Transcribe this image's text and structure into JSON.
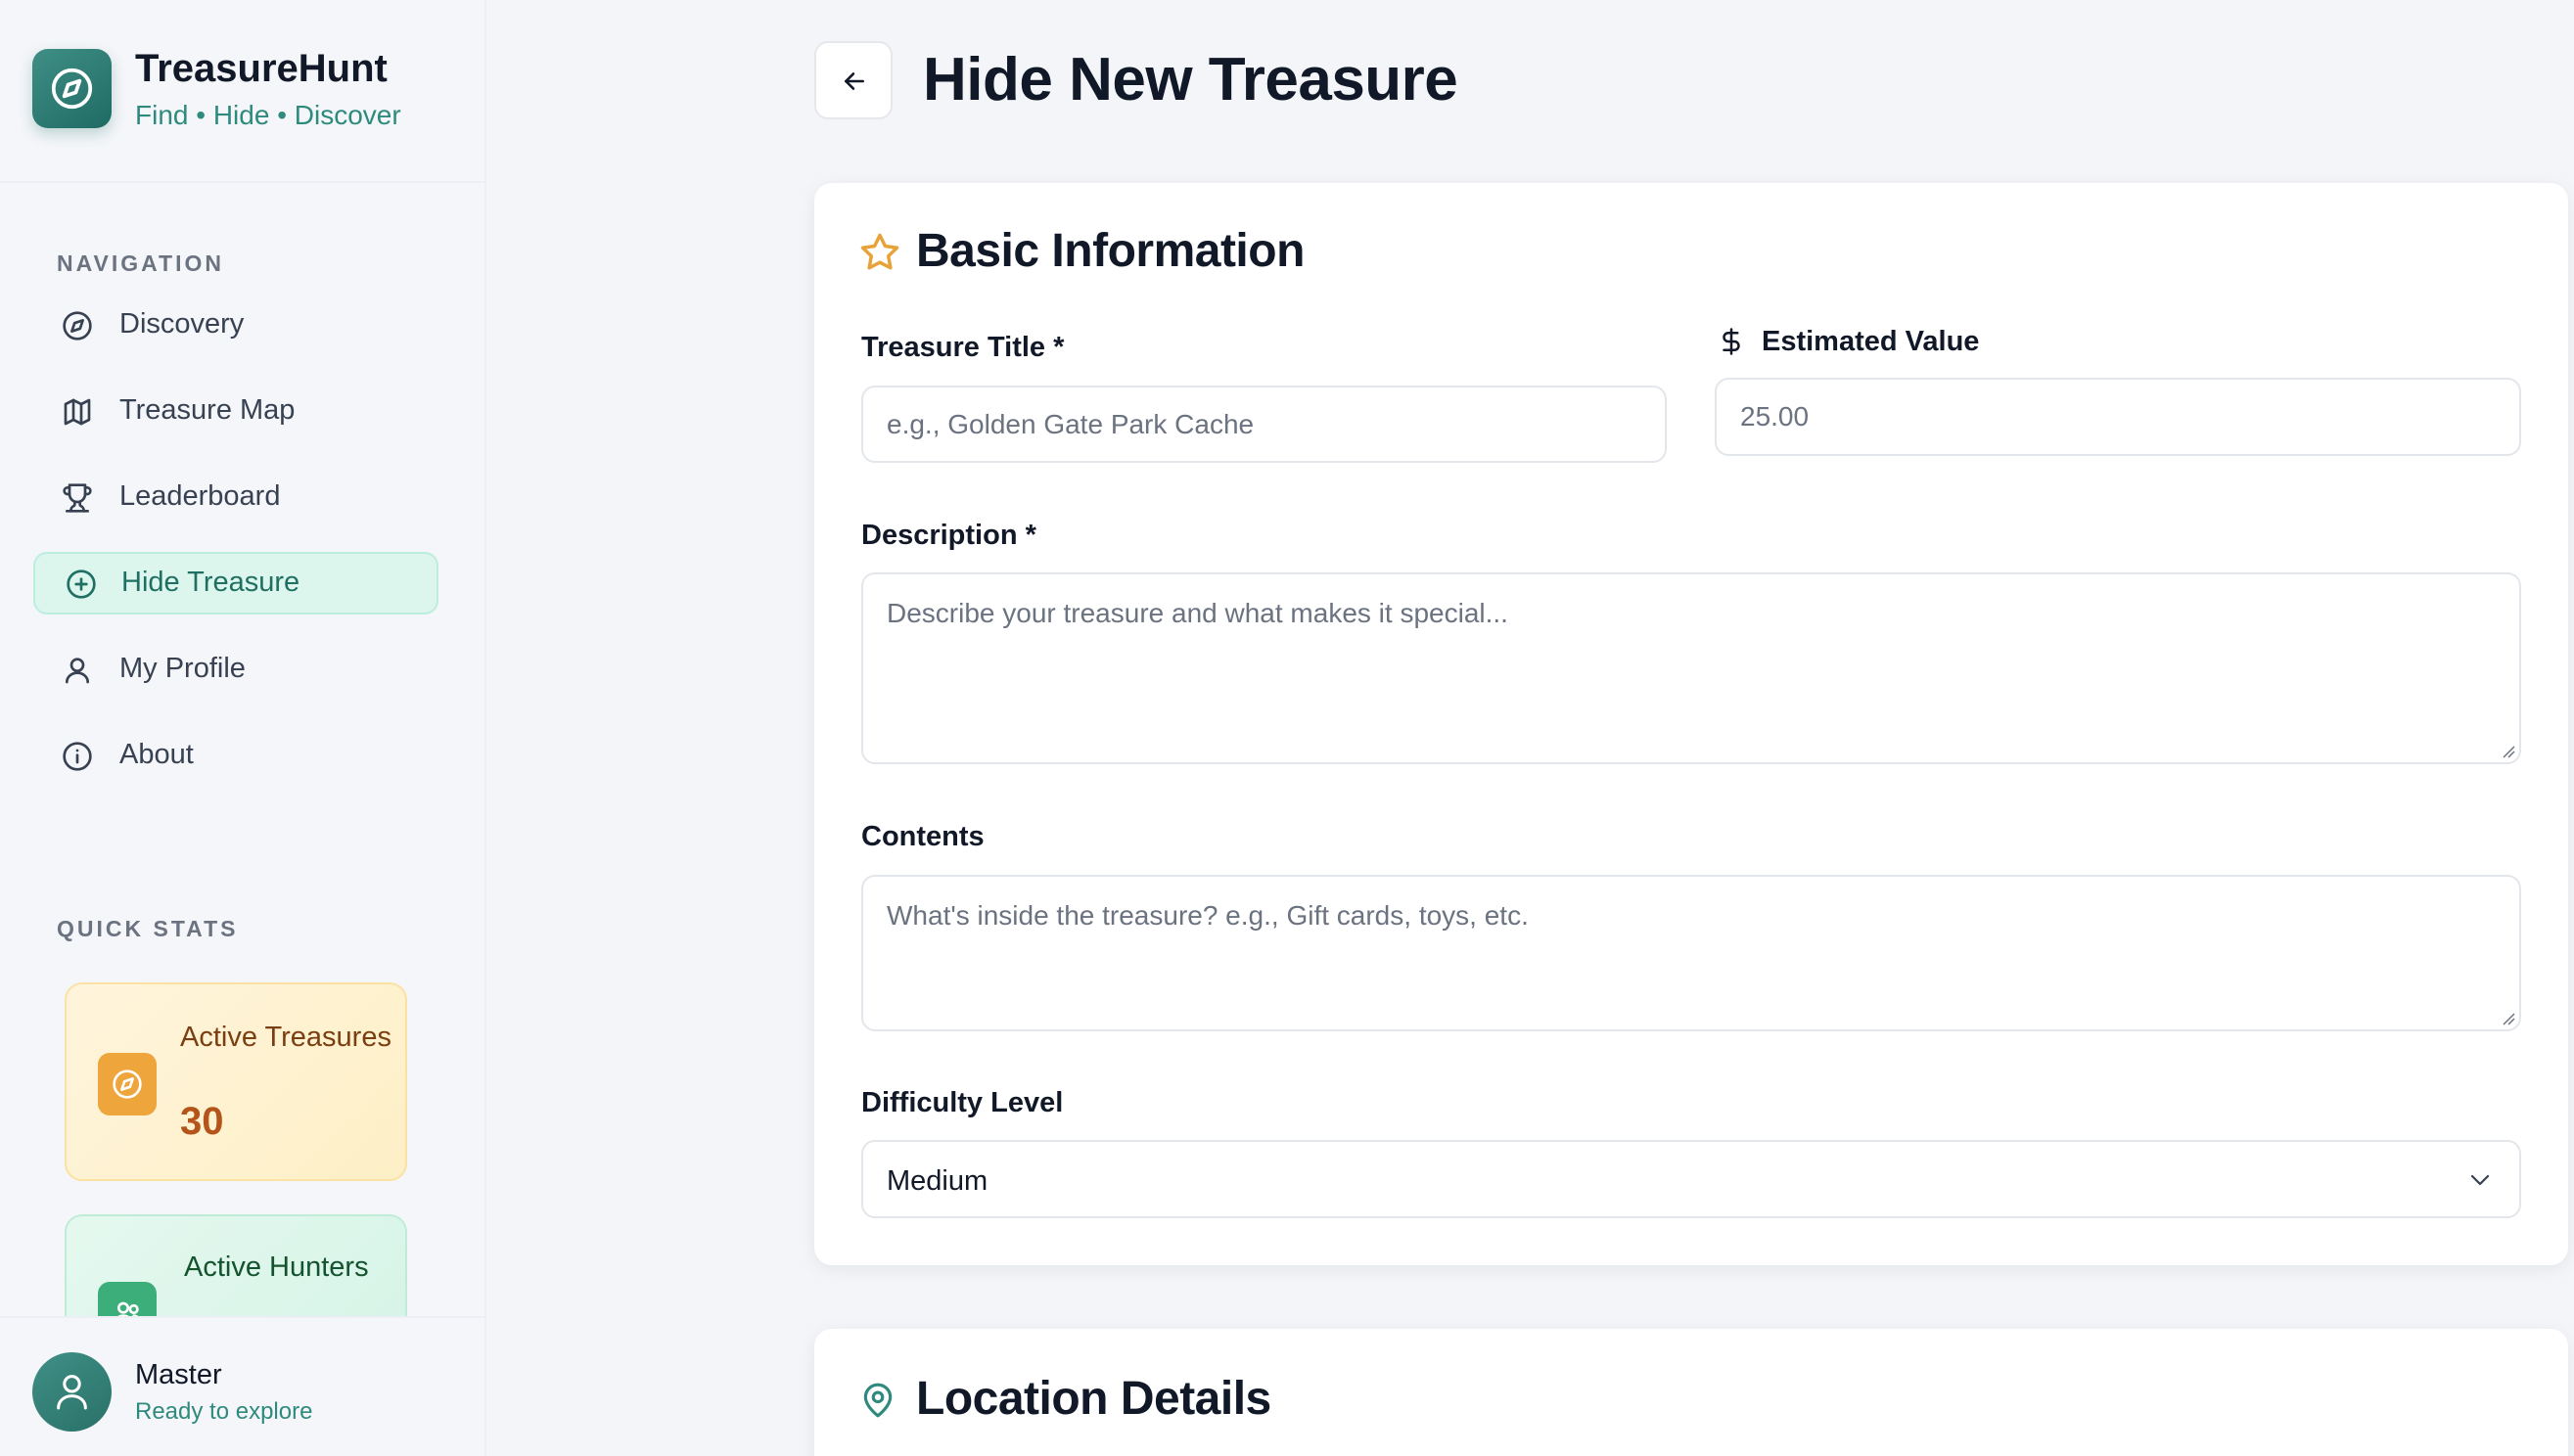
{
  "app": {
    "name": "TreasureHunt",
    "tagline": "Find • Hide • Discover"
  },
  "sidebar": {
    "nav_heading": "NAVIGATION",
    "nav_items": [
      {
        "label": "Discovery",
        "icon": "compass-icon"
      },
      {
        "label": "Treasure Map",
        "icon": "map-icon"
      },
      {
        "label": "Leaderboard",
        "icon": "trophy-icon"
      },
      {
        "label": "Hide Treasure",
        "icon": "plus-circle-icon",
        "active": true
      },
      {
        "label": "My Profile",
        "icon": "user-icon"
      },
      {
        "label": "About",
        "icon": "info-icon"
      }
    ],
    "stats_heading": "QUICK STATS",
    "stats": [
      {
        "label": "Active Treasures",
        "value": "30",
        "icon": "compass-icon",
        "color": "#eea53b"
      },
      {
        "label": "Active Hunters",
        "value": "",
        "icon": "users-icon",
        "color": "#3bae79"
      }
    ],
    "user": {
      "name": "Master",
      "status": "Ready to explore"
    }
  },
  "main": {
    "title": "Hide New Treasure",
    "basic_info": {
      "heading": "Basic Information",
      "title_label": "Treasure Title *",
      "title_placeholder": "e.g., Golden Gate Park Cache",
      "value_label": "Estimated Value",
      "value_placeholder": "25.00",
      "description_label": "Description *",
      "description_placeholder": "Describe your treasure and what makes it special...",
      "contents_label": "Contents",
      "contents_placeholder": "What's inside the treasure? e.g., Gift cards, toys, etc.",
      "difficulty_label": "Difficulty Level",
      "difficulty_value": "Medium"
    },
    "location": {
      "heading": "Location Details"
    }
  },
  "colors": {
    "brand": "#2f8a7e",
    "accent_star": "#e8a23a",
    "active_nav_bg": "#dcf6ee"
  }
}
